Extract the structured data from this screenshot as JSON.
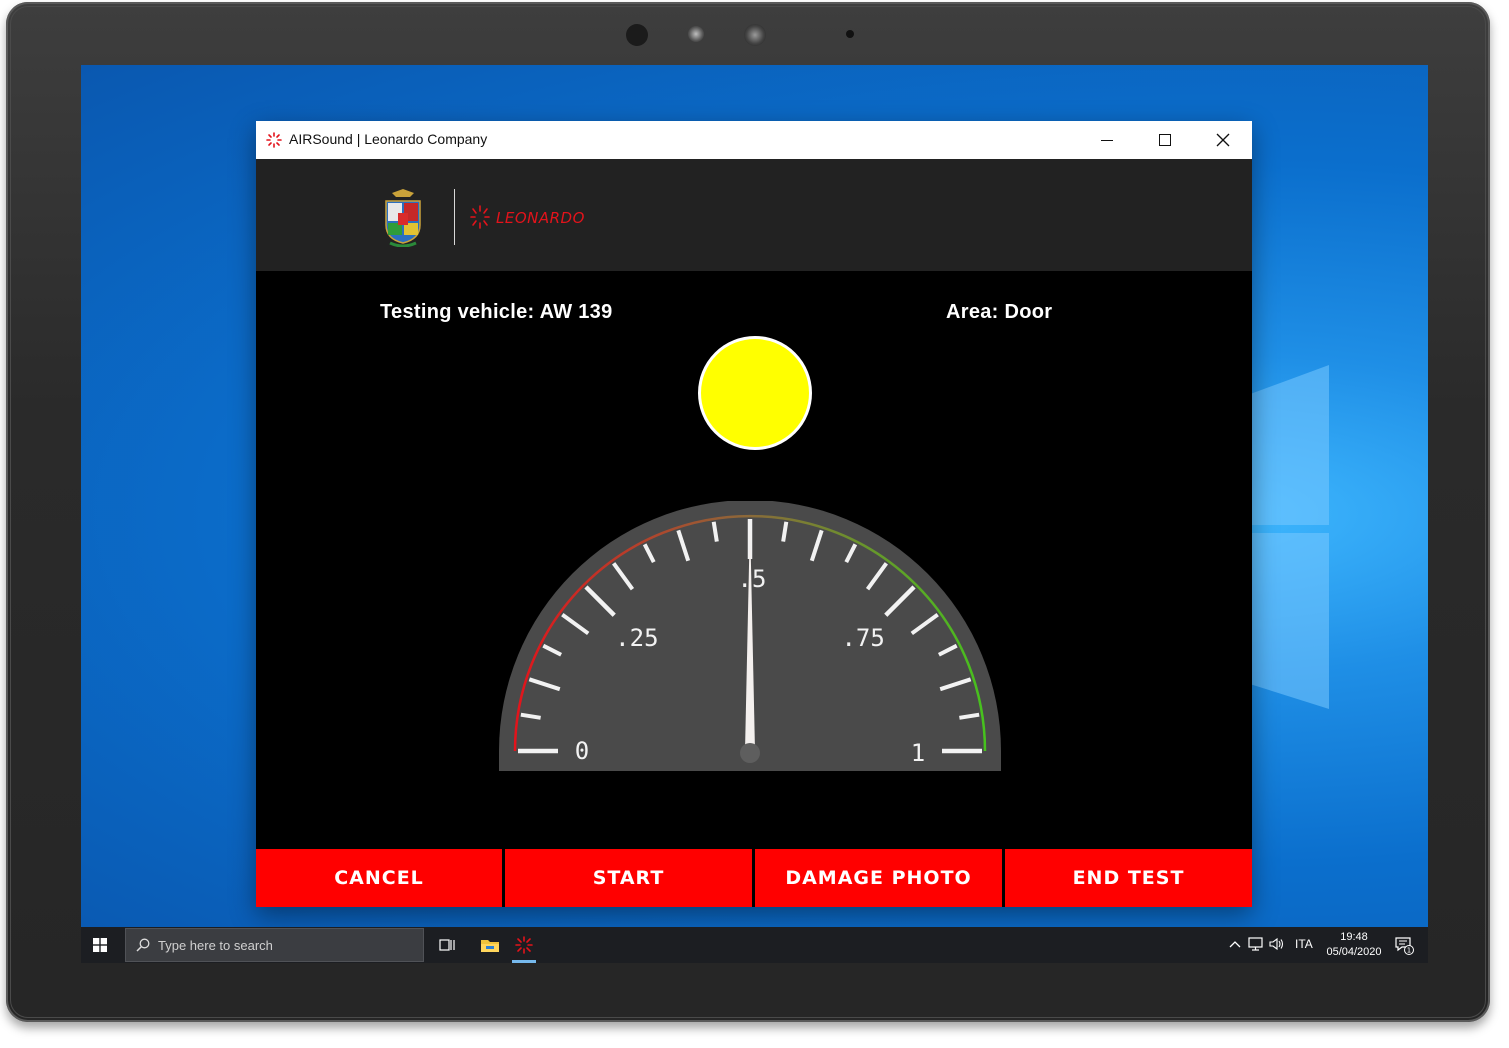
{
  "window": {
    "title": "AIRSound | Leonardo Company",
    "icons": {
      "app": "leonardo-spark-icon",
      "minimize": "minimize-icon",
      "maximize": "maximize-icon",
      "close": "close-icon"
    }
  },
  "header": {
    "crest_name": "air-force-crest-icon",
    "brand": "LEONARDO",
    "brand_color": "#e3131b"
  },
  "info": {
    "vehicle": "Testing vehicle: AW 139",
    "area": "Area: Door"
  },
  "status_indicator": {
    "color": "#ffff00"
  },
  "gauge": {
    "min": 0,
    "max": 1,
    "labels": [
      "0",
      ".25",
      ".5",
      ".75",
      "1"
    ],
    "label_values": [
      0,
      0.25,
      0.5,
      0.75,
      1
    ],
    "value": 0.5,
    "arc_colors": [
      "#e3131b",
      "#8a6a3a",
      "#46c21d"
    ]
  },
  "buttons": {
    "cancel": "CANCEL",
    "start": "START",
    "damage_photo": "DAMAGE PHOTO",
    "end_test": "END TEST",
    "color": "#ff0000"
  },
  "taskbar": {
    "search_placeholder": "Type here to search",
    "language": "ITA",
    "time": "19:48",
    "date": "05/04/2020",
    "notification_count": "1",
    "icons": [
      "windows-start-icon",
      "search-icon",
      "task-view-icon",
      "file-explorer-icon",
      "airsound-app-icon",
      "chevron-up-icon",
      "network-icon",
      "volume-icon",
      "notification-icon"
    ]
  }
}
